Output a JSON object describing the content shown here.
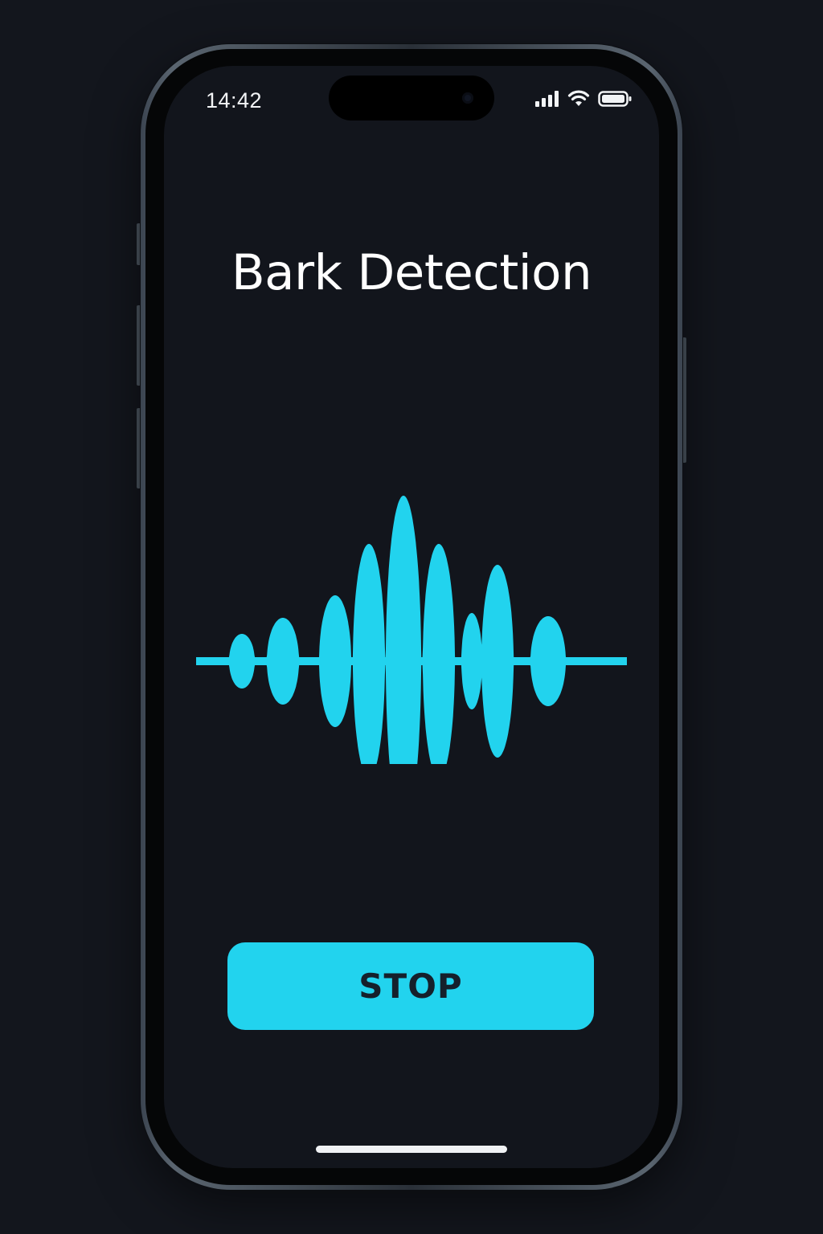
{
  "status_bar": {
    "time": "14:42",
    "icons": [
      "cellular-signal-icon",
      "wifi-icon",
      "battery-icon"
    ]
  },
  "screen": {
    "title": "Bark Detection",
    "waveform_icon": "sound-waveform-icon",
    "stop_button_label": "STOP"
  },
  "colors": {
    "accent": "#22d3ee",
    "background": "#12151c",
    "title_text": "#ffffff",
    "button_text": "#15202b"
  }
}
